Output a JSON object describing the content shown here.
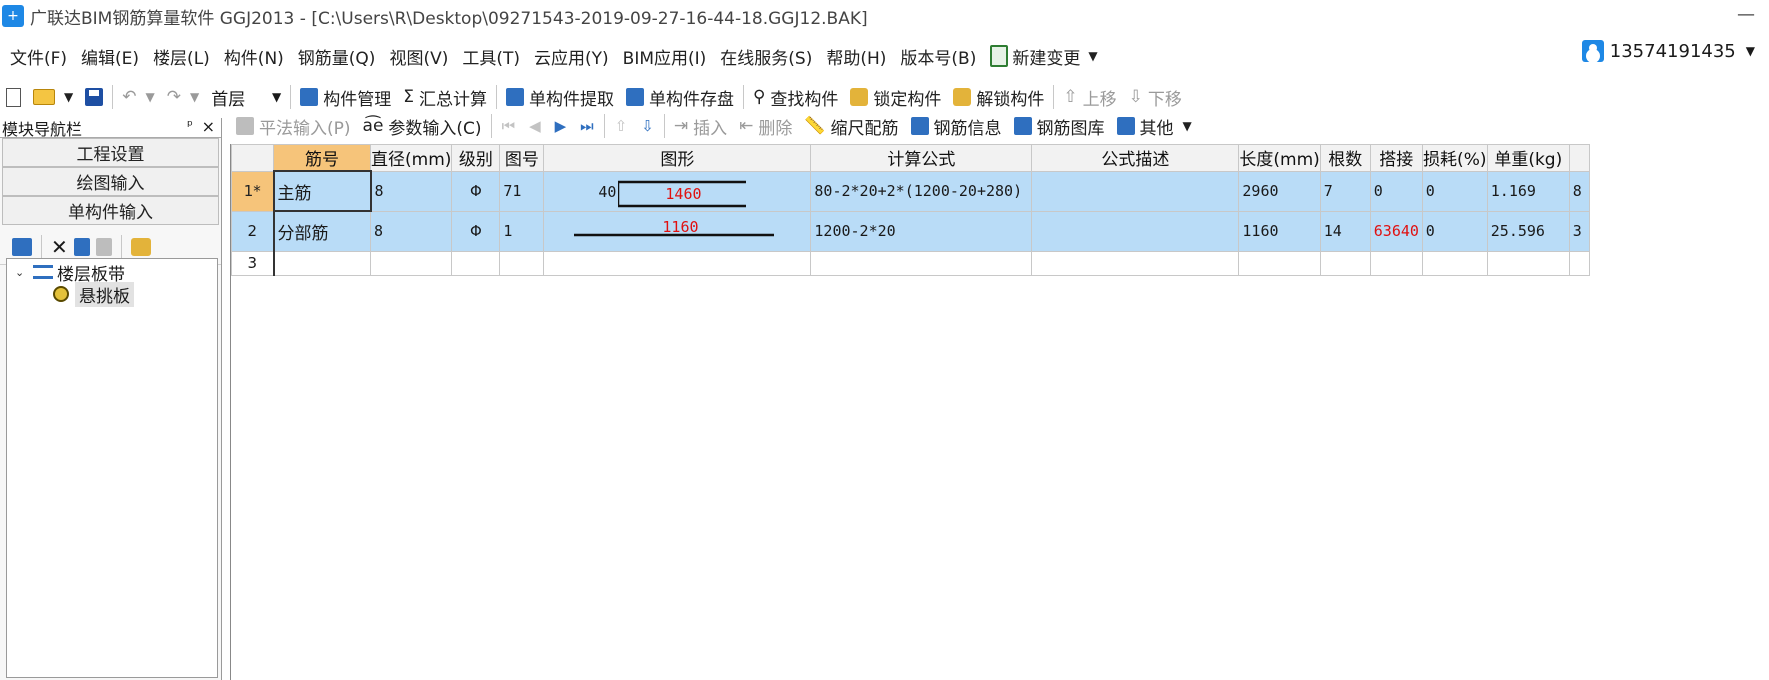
{
  "window": {
    "title": "广联达BIM钢筋算量软件 GGJ2013 - [C:\\Users\\R\\Desktop\\09271543-2019-09-27-16-44-18.GGJ12.BAK]",
    "minimize_glyph": "—"
  },
  "menu": {
    "items": [
      "文件(F)",
      "编辑(E)",
      "楼层(L)",
      "构件(N)",
      "钢筋量(Q)",
      "视图(V)",
      "工具(T)",
      "云应用(Y)",
      "BIM应用(I)",
      "在线服务(S)",
      "帮助(H)",
      "版本号(B)"
    ],
    "new_change": "新建变更",
    "user": "13574191435"
  },
  "toolbar1": {
    "floor": "首层",
    "component_manage": "构件管理",
    "sum_calc": "汇总计算",
    "single_extract": "单构件提取",
    "single_save": "单构件存盘",
    "find_component": "查找构件",
    "lock_component": "锁定构件",
    "unlock_component": "解锁构件",
    "move_up": "上移",
    "move_down": "下移"
  },
  "nav": {
    "title": "模块导航栏",
    "pin": "ᵖ",
    "close": "×",
    "tabs": [
      "工程设置",
      "绘图输入",
      "单构件输入"
    ],
    "tree_parent": "楼层板带",
    "tree_child": "悬挑板"
  },
  "toolbar2": {
    "flat_input": "平法输入(P)",
    "param_input": "参数输入(C)",
    "insert": "插入",
    "delete": "删除",
    "scale_rebar": "缩尺配筋",
    "rebar_info": "钢筋信息",
    "rebar_library": "钢筋图库",
    "other": "其他"
  },
  "grid": {
    "headers": [
      "",
      "筋号",
      "直径(mm)",
      "级别",
      "图号",
      "图形",
      "计算公式",
      "公式描述",
      "长度(mm)",
      "根数",
      "搭接",
      "损耗(%)",
      "单重(kg)",
      ""
    ],
    "rows": [
      {
        "num": "1*",
        "name": "主筋",
        "diameter": "8",
        "grade": "Φ",
        "figure_no": "71",
        "shape_left": "40",
        "shape_value": "1460",
        "formula": "80-2*20+2*(1200-20+280)",
        "desc": "",
        "length": "2960",
        "count": "7",
        "lap": "0",
        "loss": "0",
        "unit_weight": "1.169",
        "more": "8"
      },
      {
        "num": "2",
        "name": "分部筋",
        "diameter": "8",
        "grade": "Φ",
        "figure_no": "1",
        "shape_value": "1160",
        "formula": "1200-2*20",
        "desc": "",
        "length": "1160",
        "count": "14",
        "lap": "63640",
        "loss": "0",
        "unit_weight": "25.596",
        "more": "3"
      },
      {
        "num": "3"
      }
    ]
  },
  "colors": {
    "selection": "#b9dcf7",
    "active_header": "#f6c47a",
    "red_text": "#e01010"
  }
}
